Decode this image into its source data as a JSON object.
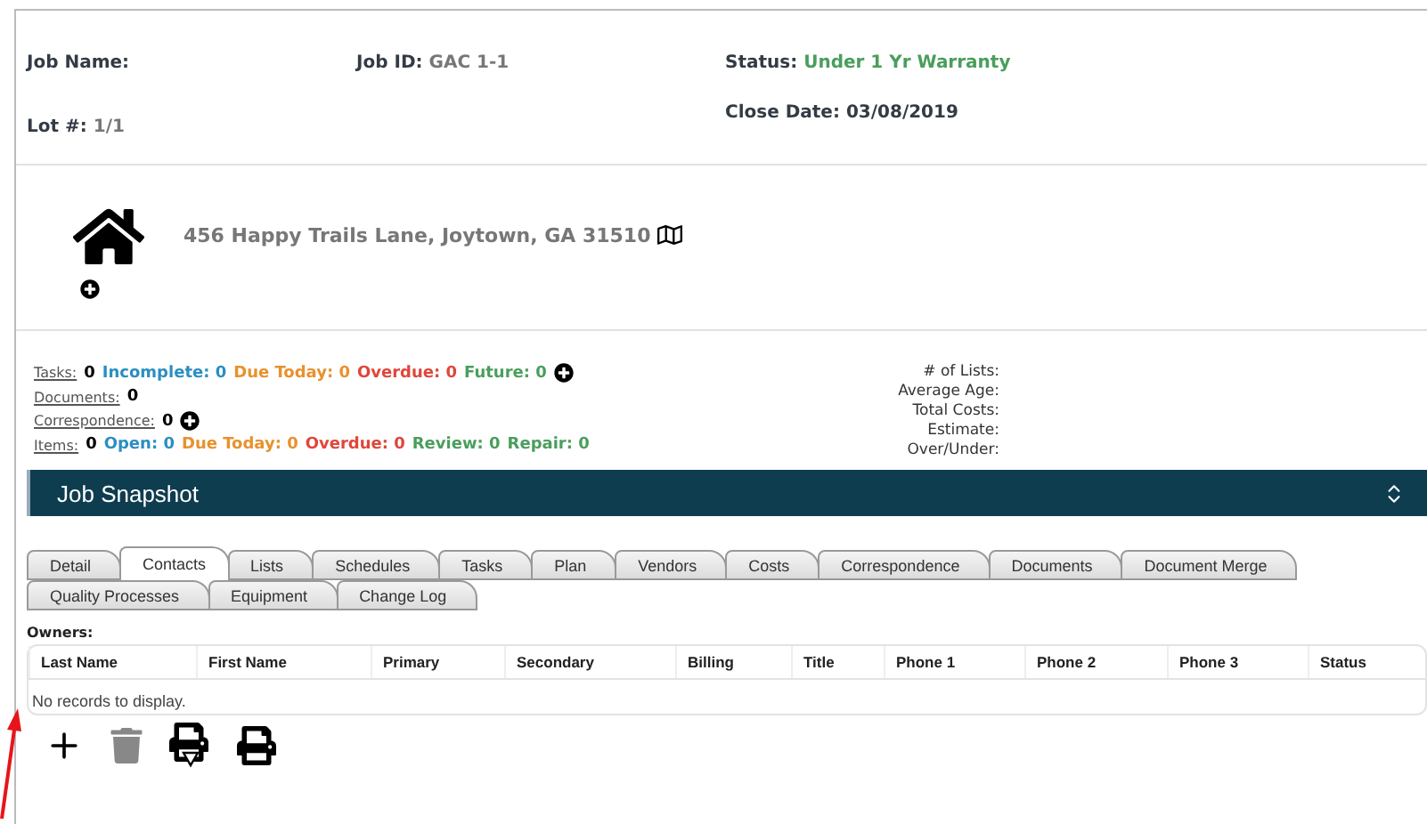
{
  "header": {
    "job_name": {
      "label": "Job Name:"
    },
    "job_id": {
      "label": "Job ID:",
      "value": "GAC 1-1"
    },
    "status": {
      "label": "Status:",
      "value": "Under 1 Yr Warranty"
    },
    "lot": {
      "label": "Lot #:",
      "value": "1/1"
    },
    "close_date": {
      "label": "Close Date:",
      "value": "03/08/2019"
    }
  },
  "address": "456 Happy Trails Lane, Joytown, GA 31510",
  "summary": [
    {
      "link": "Tasks:",
      "count": "0",
      "has_add": true,
      "statuses": [
        {
          "label": "Incomplete:",
          "value": "0",
          "color": "#2a8fc1"
        },
        {
          "label": "Due Today:",
          "value": "0",
          "color": "#e8912d"
        },
        {
          "label": "Overdue:",
          "value": "0",
          "color": "#e0463a"
        },
        {
          "label": "Future:",
          "value": "0",
          "color": "#4a9e5c"
        }
      ]
    },
    {
      "link": "Documents:",
      "count": "0",
      "has_add": false
    },
    {
      "link": "Correspondence:",
      "count": "0",
      "has_add": true
    },
    {
      "link": "Items:",
      "count": "0",
      "has_add": false,
      "statuses": [
        {
          "label": "Open:",
          "value": "0",
          "color": "#2a8fc1"
        },
        {
          "label": "Due Today:",
          "value": "0",
          "color": "#e8912d"
        },
        {
          "label": "Overdue:",
          "value": "0",
          "color": "#e0463a"
        },
        {
          "label": "Review:",
          "value": "0",
          "color": "#4a9e5c"
        },
        {
          "label": "Repair:",
          "value": "0",
          "color": "#4a9e5c"
        }
      ]
    }
  ],
  "metrics": [
    "# of Lists:",
    "Average Age:",
    "Total Costs:",
    "Estimate:",
    "Over/Under:"
  ],
  "snapshot": {
    "title": "Job Snapshot"
  },
  "tabs": [
    [
      {
        "label": "Detail",
        "selected": false
      },
      {
        "label": "Contacts",
        "selected": true
      },
      {
        "label": "Lists",
        "selected": false
      },
      {
        "label": "Schedules",
        "selected": false
      },
      {
        "label": "Tasks",
        "selected": false
      },
      {
        "label": "Plan",
        "selected": false
      },
      {
        "label": "Vendors",
        "selected": false
      },
      {
        "label": "Costs",
        "selected": false
      },
      {
        "label": "Correspondence",
        "selected": false
      },
      {
        "label": "Documents",
        "selected": false
      },
      {
        "label": "Document Merge",
        "selected": false
      }
    ],
    [
      {
        "label": "Quality Processes",
        "selected": false
      },
      {
        "label": "Equipment",
        "selected": false
      },
      {
        "label": "Change Log",
        "selected": false
      }
    ]
  ],
  "owners": {
    "label": "Owners:",
    "columns": [
      "Last Name",
      "First Name",
      "Primary",
      "Secondary",
      "Billing",
      "Title",
      "Phone 1",
      "Phone 2",
      "Phone 3",
      "Status"
    ],
    "empty_text": "No records to display."
  }
}
